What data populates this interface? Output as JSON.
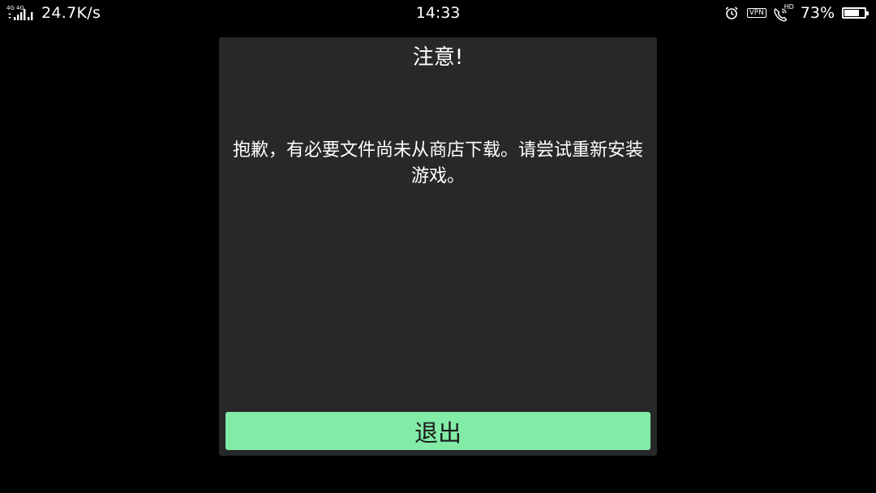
{
  "status_bar": {
    "network_types": [
      "4G",
      "4G"
    ],
    "net_speed": "24.7K/s",
    "time": "14:33",
    "alarm_icon": "alarm-clock-icon",
    "vpn_label": "VPN",
    "hd_label": "HD",
    "call_icon": "phone-call-icon",
    "battery_percent": "73%",
    "battery_level": 0.73
  },
  "dialog": {
    "title": "注意!",
    "message": "抱歉，有必要文件尚未从商店下载。请尝试重新安装游戏。",
    "exit_label": "退出"
  },
  "colors": {
    "background": "#000000",
    "dialog_bg": "#262829",
    "button_bg": "#82eba6",
    "button_text": "#1a1a1a",
    "text": "#ffffff"
  }
}
